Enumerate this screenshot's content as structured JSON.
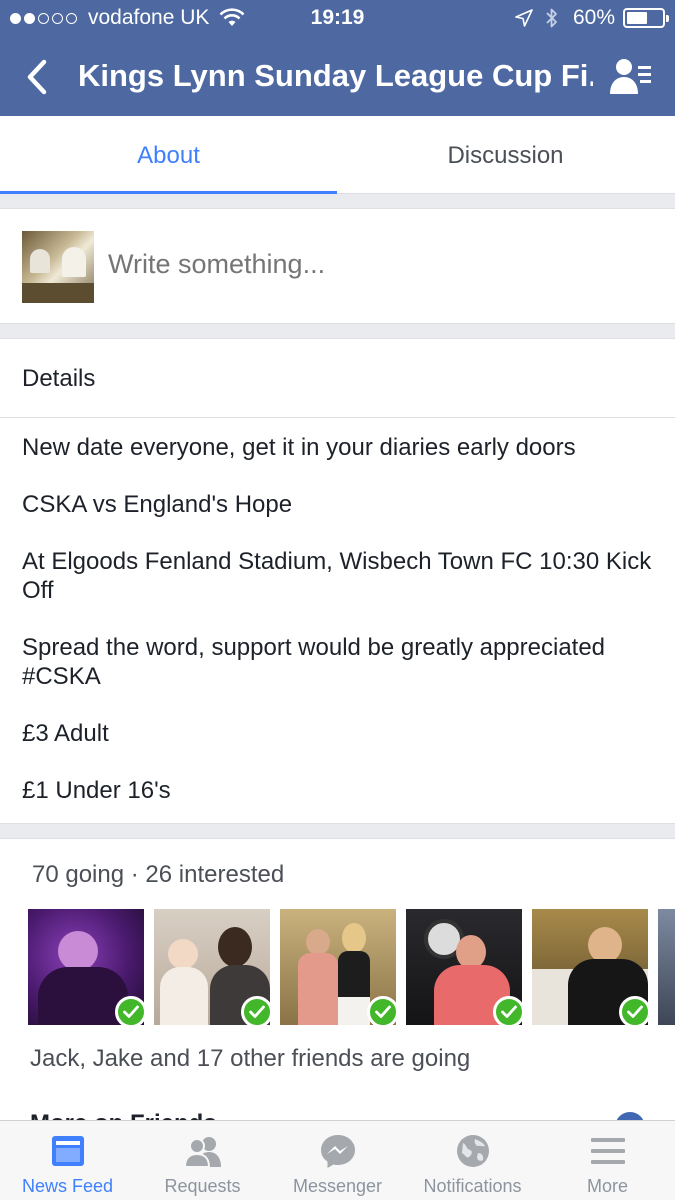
{
  "status_bar": {
    "carrier": "vodafone UK",
    "time": "19:19",
    "battery": "60%",
    "battery_level": 0.6
  },
  "nav": {
    "title": "Kings Lynn Sunday League Cup Fi...",
    "back_icon": "chevron-left-icon",
    "right_icon": "guest-list-icon"
  },
  "tabs": [
    {
      "label": "About",
      "active": true
    },
    {
      "label": "Discussion",
      "active": false
    }
  ],
  "composer": {
    "placeholder": "Write something..."
  },
  "details": {
    "heading": "Details",
    "paragraphs": [
      "New date everyone, get it in your diaries early doors",
      "CSKA vs England's Hope",
      "At Elgoods Fenland Stadium, Wisbech Town FC 10:30 Kick Off",
      "Spread the word, support would be greatly appreciated #CSKA",
      "£3 Adult",
      "£1 Under 16's"
    ]
  },
  "going": {
    "summary": "70 going · 26 interested",
    "friends_text": "Jack, Jake and 17 other friends are going",
    "photo_count": 6
  },
  "next_section": {
    "title": "More on Friends"
  },
  "tabbar": {
    "items": [
      {
        "label": "News Feed",
        "icon": "news-feed-icon",
        "active": true
      },
      {
        "label": "Requests",
        "icon": "friend-requests-icon",
        "active": false
      },
      {
        "label": "Messenger",
        "icon": "messenger-icon",
        "active": false
      },
      {
        "label": "Notifications",
        "icon": "globe-icon",
        "active": false
      },
      {
        "label": "More",
        "icon": "menu-icon",
        "active": false
      }
    ]
  },
  "colors": {
    "brand": "#4e69a2",
    "accent": "#4080ff",
    "going_check": "#42b72a"
  }
}
